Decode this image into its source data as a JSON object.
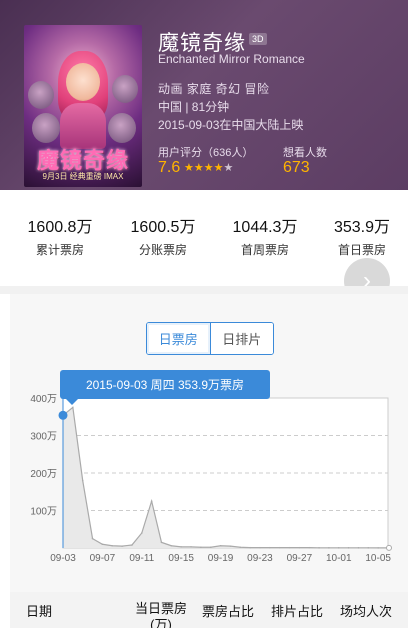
{
  "movie": {
    "title": "魔镜奇缘",
    "format_badge": "3D",
    "english_title": "Enchanted Mirror Romance",
    "genres": "动画 家庭 奇幻 冒险",
    "country_duration": "中国 | 81分钟",
    "release": "2015-09-03在中国大陆上映",
    "poster_title": "魔镜奇缘",
    "poster_date": "9月3日 经典重磅 IMAX",
    "rating_label": "用户评分（636人）",
    "rating_value": "7.6",
    "stars": 3.5,
    "want_label": "想看人数",
    "want_value": "673"
  },
  "stats": [
    {
      "value": "1600.8万",
      "label": "累计票房"
    },
    {
      "value": "1600.5万",
      "label": "分账票房"
    },
    {
      "value": "1044.3万",
      "label": "首周票房"
    },
    {
      "value": "353.9万",
      "label": "首日票房"
    }
  ],
  "next_button_icon": "chevron-right-icon",
  "tabs": [
    {
      "label": "日票房",
      "active": true
    },
    {
      "label": "日排片",
      "active": false
    }
  ],
  "tooltip": "2015-09-03 周四 353.9万票房",
  "chart_data": {
    "type": "area",
    "title": "",
    "xlabel": "",
    "ylabel": "",
    "ylim": [
      0,
      400
    ],
    "yticks": [
      "100万",
      "200万",
      "300万",
      "400万"
    ],
    "xticks": [
      "09-03",
      "09-07",
      "09-11",
      "09-15",
      "09-19",
      "09-23",
      "09-27",
      "10-01",
      "10-05"
    ],
    "grid": true,
    "series": [
      {
        "x": [
          "09-03",
          "09-04",
          "09-05",
          "09-06",
          "09-07",
          "09-08",
          "09-09",
          "09-10",
          "09-11",
          "09-12",
          "09-13",
          "09-14",
          "09-15",
          "09-16",
          "09-17",
          "09-18",
          "09-19",
          "09-20",
          "09-21",
          "09-22",
          "09-23",
          "09-24",
          "09-25",
          "09-26",
          "09-27",
          "09-28",
          "09-29",
          "09-30",
          "10-01",
          "10-02",
          "10-03",
          "10-04",
          "10-05",
          "10-06"
        ],
        "values": [
          353.9,
          375,
          180,
          25,
          10,
          6,
          5,
          8,
          40,
          125,
          15,
          6,
          3,
          3,
          2,
          2,
          6,
          5,
          2,
          1,
          1,
          1,
          1,
          1,
          1,
          1,
          0.5,
          0.5,
          0.5,
          0.5,
          0.5,
          0.5,
          0.3,
          0.3
        ]
      }
    ],
    "highlight_index": 0,
    "line_color": "#aaaaaa",
    "fill_color": "#e9e9e9",
    "highlight_color": "#3b8ad9"
  },
  "table_headers": [
    "日期",
    "当日票房(万)",
    "票房占比",
    "排片占比",
    "场均人次"
  ]
}
